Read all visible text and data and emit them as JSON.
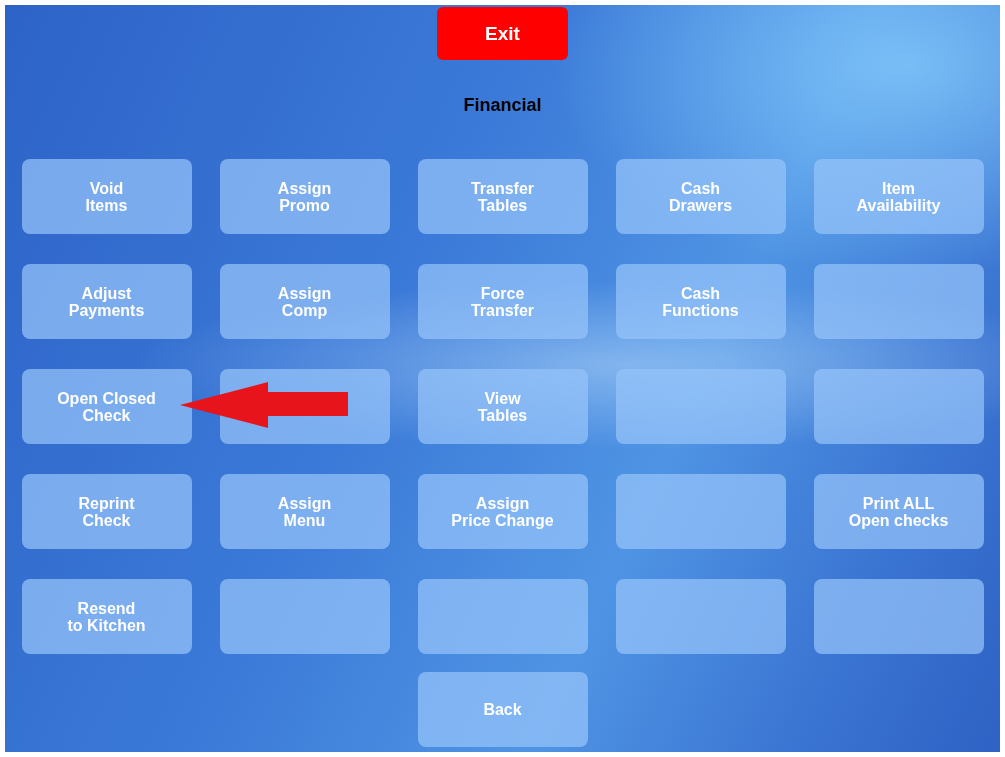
{
  "exit_button": {
    "label": "Exit"
  },
  "title": "Financial",
  "buttons": [
    {
      "kind": "action",
      "label": "Void\nItems"
    },
    {
      "kind": "action",
      "label": "Assign\nPromo"
    },
    {
      "kind": "action",
      "label": "Transfer\nTables"
    },
    {
      "kind": "action",
      "label": "Cash\nDrawers"
    },
    {
      "kind": "action",
      "label": "Item\nAvailability"
    },
    {
      "kind": "action",
      "label": "Adjust\nPayments"
    },
    {
      "kind": "action",
      "label": "Assign\nComp"
    },
    {
      "kind": "action",
      "label": "Force\nTransfer"
    },
    {
      "kind": "action",
      "label": "Cash\nFunctions"
    },
    {
      "kind": "empty"
    },
    {
      "kind": "action",
      "label": "Open Closed\nCheck"
    },
    {
      "kind": "empty"
    },
    {
      "kind": "action",
      "label": "View\nTables"
    },
    {
      "kind": "empty"
    },
    {
      "kind": "empty"
    },
    {
      "kind": "action",
      "label": "Reprint\nCheck"
    },
    {
      "kind": "action",
      "label": "Assign\nMenu"
    },
    {
      "kind": "action",
      "label": "Assign\nPrice Change"
    },
    {
      "kind": "empty"
    },
    {
      "kind": "action",
      "label": "Print ALL\nOpen checks"
    },
    {
      "kind": "action",
      "label": "Resend\nto Kitchen"
    },
    {
      "kind": "empty"
    },
    {
      "kind": "empty"
    },
    {
      "kind": "empty"
    },
    {
      "kind": "empty"
    }
  ],
  "back_button": {
    "label": "Back"
  }
}
